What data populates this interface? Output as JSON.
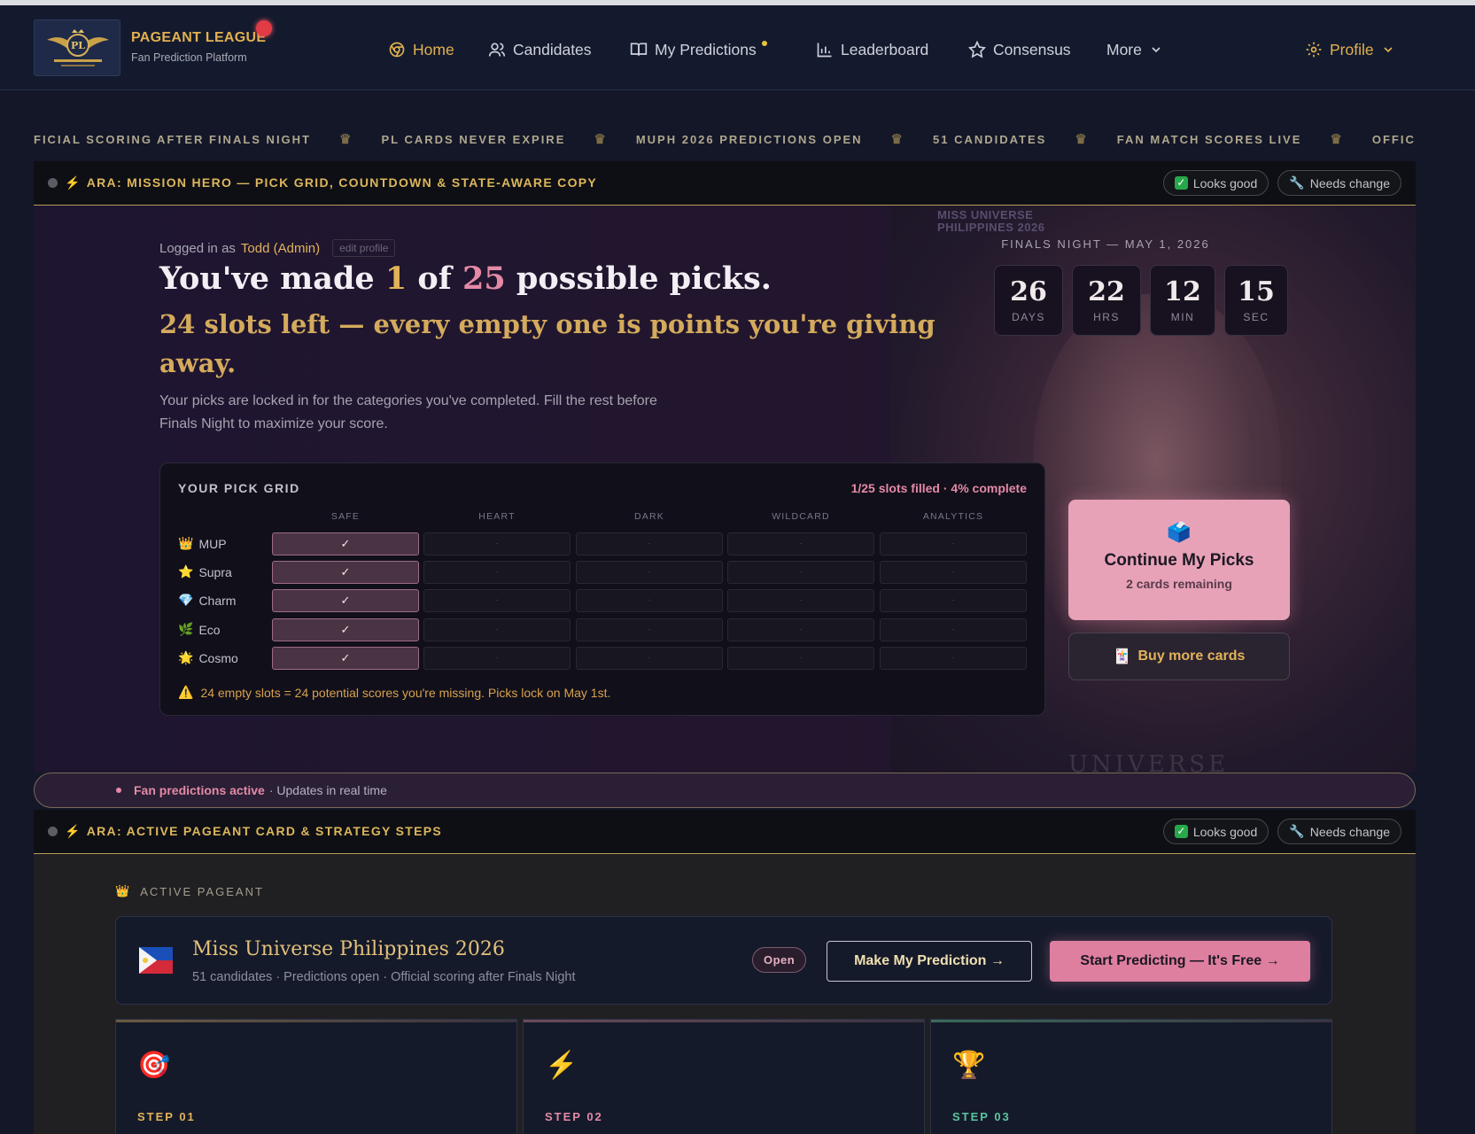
{
  "nav": {
    "brand_title": "PAGEANT LEAGUE",
    "brand_sub": "Fan Prediction Platform",
    "items": [
      {
        "label": "Home",
        "icon": "chrome-icon"
      },
      {
        "label": "Candidates",
        "icon": "users-icon"
      },
      {
        "label": "My Predictions",
        "icon": "book-icon"
      },
      {
        "label": "Leaderboard",
        "icon": "bar-chart-icon"
      },
      {
        "label": "Consensus",
        "icon": "star-icon"
      },
      {
        "label": "More",
        "icon": "chevron-down-icon"
      }
    ],
    "profile": "Profile"
  },
  "ticker": [
    "FICIAL SCORING AFTER FINALS NIGHT",
    "PL CARDS NEVER EXPIRE",
    "MUPH 2026 PREDICTIONS OPEN",
    "51 CANDIDATES",
    "FAN MATCH SCORES LIVE",
    "OFFIC"
  ],
  "review1": {
    "title": "ARA: MISSION HERO — PICK GRID, COUNTDOWN & STATE-AWARE COPY",
    "good": "Looks good",
    "change": "Needs change"
  },
  "review2": {
    "title": "ARA: ACTIVE PAGEANT CARD & STRATEGY STEPS",
    "good": "Looks good",
    "change": "Needs change"
  },
  "hero": {
    "logged_prefix": "Logged in as",
    "user": "Todd (Admin)",
    "edit": "edit profile",
    "head_a": "You've made ",
    "head_n1": "1",
    "head_b": " of ",
    "head_n2": "25",
    "head_c": " possible picks.",
    "sub": "24 slots left — every empty one is points you're giving away.",
    "desc": "Your picks are locked in for the categories you've completed. Fill the rest before Finals Night to maximize your score.",
    "finals": "FINALS NIGHT — MAY 1, 2026",
    "countdown": [
      {
        "num": "26",
        "label": "DAYS"
      },
      {
        "num": "22",
        "label": "HRS"
      },
      {
        "num": "12",
        "label": "MIN"
      },
      {
        "num": "15",
        "label": "SEC"
      }
    ],
    "watermark_top": "MISS UNIVERSE PHILIPPINES 2026",
    "watermark_bottom": "UNIVERSE"
  },
  "grid": {
    "title": "YOUR PICK GRID",
    "status": "1/25 slots filled · 4% complete",
    "columns": [
      "SAFE",
      "HEART",
      "DARK",
      "WILDCARD",
      "ANALYTICS"
    ],
    "rows": [
      {
        "emoji": "👑",
        "label": "MUP"
      },
      {
        "emoji": "⭐",
        "label": "Supra"
      },
      {
        "emoji": "💎",
        "label": "Charm"
      },
      {
        "emoji": "🌿",
        "label": "Eco"
      },
      {
        "emoji": "🌟",
        "label": "Cosmo"
      }
    ],
    "check": "✓",
    "empty": "·",
    "warning": "24 empty slots = 24 potential scores you're missing. Picks lock on May 1st."
  },
  "cta": {
    "continue_title": "Continue My Picks",
    "continue_sub": "2 cards remaining",
    "buy": "Buy more cards"
  },
  "fan": {
    "bold": "Fan predictions active",
    "rest": "· Updates in real time"
  },
  "pageant": {
    "label": "ACTIVE PAGEANT",
    "name": "Miss Universe Philippines 2026",
    "meta": "51 candidates · Predictions open · Official scoring after Finals Night",
    "badge": "Open",
    "make": "Make My Prediction →",
    "start": "Start Predicting — It's Free →"
  },
  "steps": [
    {
      "icon": "🎯",
      "label": "STEP 01",
      "color": "#e2b35a"
    },
    {
      "icon": "⚡",
      "label": "STEP 02",
      "color": "#e48aa6"
    },
    {
      "icon": "🏆",
      "label": "STEP 03",
      "color": "#5cc4a0"
    }
  ],
  "colors": {
    "gold": "#e2b35a",
    "pink": "#e48aa6",
    "nav_bg": "#141a2e"
  }
}
